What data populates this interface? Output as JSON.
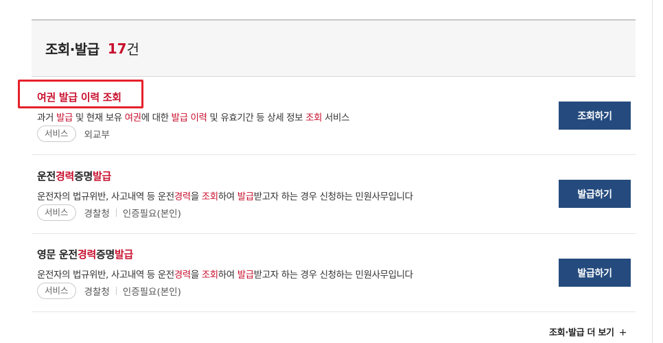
{
  "header": {
    "title": "조회·발급",
    "count": "17",
    "unit": "건"
  },
  "items": [
    {
      "title": "여권 발급 이력 조회",
      "description_parts": [
        "과거 ",
        "발급",
        " 및 현재 보유 ",
        "여권",
        "에 대한 ",
        "발급 이력",
        " 및 유효기간 등 상세 정보 ",
        "조회",
        " 서비스"
      ],
      "tag": "서비스",
      "agency": "외교부",
      "button": "조회하기",
      "highlighted": true
    },
    {
      "title_parts": [
        "운전",
        "경력",
        "증명",
        "발급"
      ],
      "description_parts": [
        "운전자의 법규위반, 사고내역 등 운전",
        "경력",
        "을 ",
        "조회",
        "하여 ",
        "발급",
        "받고자 하는 경우 신청하는 민원사무입니다"
      ],
      "tag": "서비스",
      "agency": "경찰청",
      "auth": "인증필요(본인)",
      "button": "발급하기"
    },
    {
      "title_parts": [
        "영문 운전",
        "경력",
        "증명",
        "발급"
      ],
      "description_parts": [
        "운전자의 법규위반, 사고내역 등 운전",
        "경력",
        "을 ",
        "조회",
        "하여 ",
        "발급",
        "받고자 하는 경우 신청하는 민원사무입니다"
      ],
      "tag": "서비스",
      "agency": "경찰청",
      "auth": "인증필요(본인)",
      "button": "발급하기"
    }
  ],
  "more": {
    "label": "조회·발급 더 보기",
    "icon": "+"
  },
  "colors": {
    "accent_red": "#c8102e",
    "button_blue": "#254b7e",
    "highlight_border": "#e5202a"
  }
}
